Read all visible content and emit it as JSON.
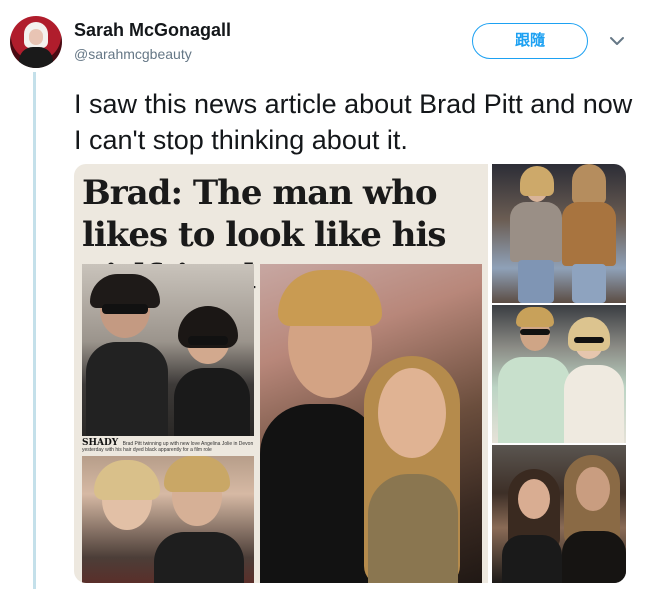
{
  "author": {
    "display_name": "Sarah McGonagall",
    "handle": "@sarahmcgbeauty"
  },
  "actions": {
    "follow_label": "跟隨"
  },
  "tweet": {
    "text": "I saw this news article about Brad Pitt and now I can't stop thinking about it."
  },
  "media": {
    "headline": "Brad: The man who likes to look like his girlfriend",
    "caption_tag": "SHADY",
    "caption_text": "Brad Pitt twinning up with new love Angelina Jolie in Devon yesterday with his hair dyed black apparently for a film role"
  },
  "colors": {
    "accent": "#1da1f2",
    "thread_line": "#c4e0ea"
  }
}
